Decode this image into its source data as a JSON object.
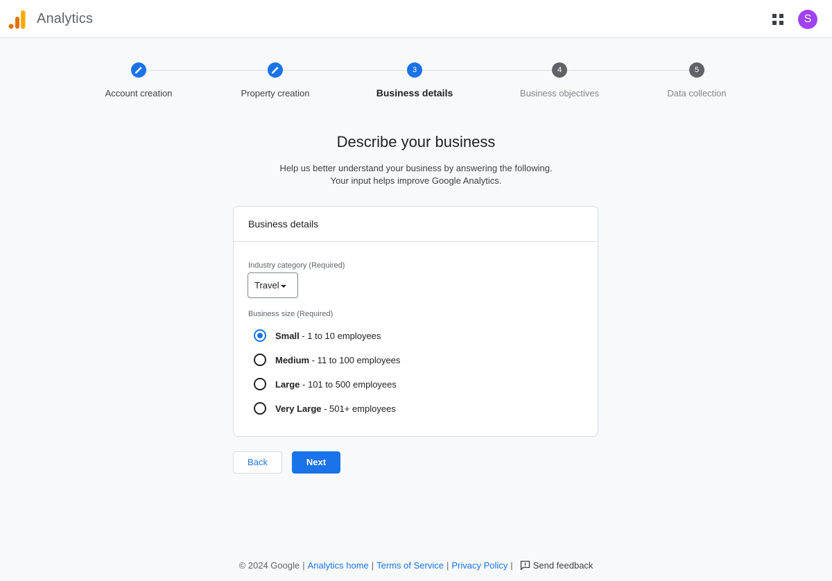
{
  "header": {
    "app_name": "Analytics",
    "logo_colors": [
      "#e37400",
      "#f9ab00",
      "#f9ab00"
    ],
    "apps_icon": "apps-grid-icon",
    "avatar_letter": "S",
    "avatar_color": "#a142f4"
  },
  "stepper": {
    "steps": [
      {
        "label": "Account creation",
        "state": "done",
        "icon": "pencil-icon"
      },
      {
        "label": "Property creation",
        "state": "done",
        "icon": "pencil-icon"
      },
      {
        "label": "Business details",
        "state": "active",
        "number": "3"
      },
      {
        "label": "Business objectives",
        "state": "pending",
        "number": "4"
      },
      {
        "label": "Data collection",
        "state": "pending",
        "number": "5"
      }
    ]
  },
  "main": {
    "title": "Describe your business",
    "subtitle_line1": "Help us better understand your business by answering the following.",
    "subtitle_line2": "Your input helps improve Google Analytics."
  },
  "card": {
    "title": "Business details",
    "industry_label": "Industry category (Required)",
    "industry_value": "Travel",
    "size_label": "Business size (Required)",
    "size_options": [
      {
        "name": "Small",
        "desc": " - 1 to 10 employees",
        "selected": true
      },
      {
        "name": "Medium",
        "desc": " - 11 to 100 employees",
        "selected": false
      },
      {
        "name": "Large",
        "desc": " - 101 to 500 employees",
        "selected": false
      },
      {
        "name": "Very Large",
        "desc": " - 501+ employees",
        "selected": false
      }
    ]
  },
  "buttons": {
    "back": "Back",
    "next": "Next"
  },
  "footer": {
    "copyright": "© 2024 Google",
    "links": [
      "Analytics home",
      "Terms of Service",
      "Privacy Policy"
    ],
    "feedback": "Send feedback",
    "feedback_icon": "feedback-icon"
  },
  "colors": {
    "accent": "#1a73e8",
    "pending_step": "#5f6368"
  }
}
